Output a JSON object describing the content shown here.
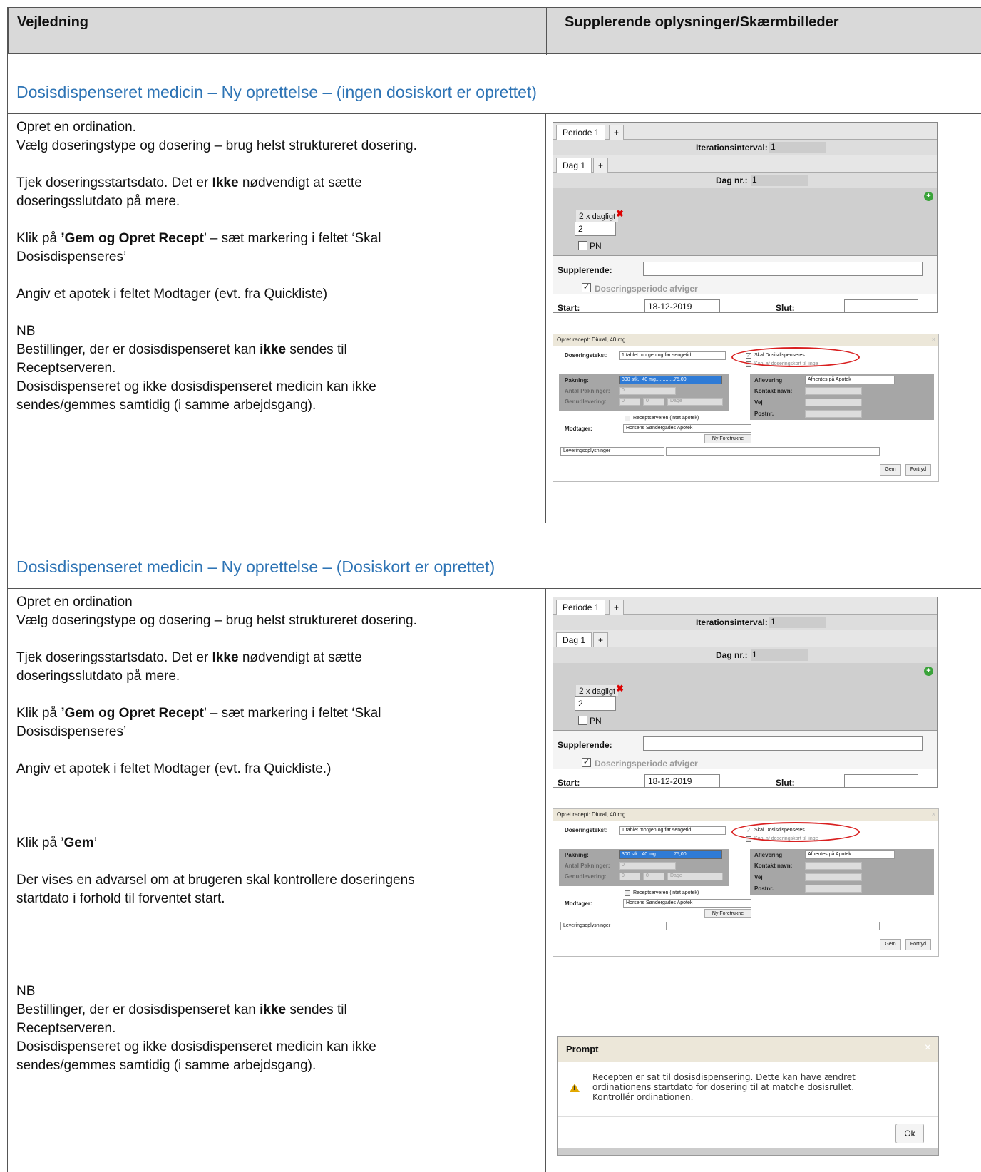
{
  "header": {
    "col1": "Vejledning",
    "col2": "Supplerende oplysninger/Skærmbilleder"
  },
  "section1": {
    "title": "Dosisdispenseret medicin – Ny oprettelse – (ingen dosiskort er oprettet)",
    "p1_l1": "Opret en ordination.",
    "p1_l2": "Vælg doseringstype og dosering – brug helst struktureret dosering.",
    "p2_a": "Tjek doseringsstartsdato. Det er ",
    "p2_b": "Ikke",
    "p2_c": " nødvendigt at sætte",
    "p2_l2": "doseringsslutdato på mere.",
    "p3_a": "Klik på ",
    "p3_b": "’Gem og Opret Recept",
    "p3_c": "’ – sæt markering i feltet ‘Skal",
    "p3_l2": "Dosisdispenseres’",
    "p4": "Angiv et apotek i feltet Modtager (evt. fra Quickliste)",
    "nb": "NB",
    "nb1_a": "Bestillinger, der er dosisdispenseret kan ",
    "nb1_b": "ikke",
    "nb1_c": " sendes til",
    "nb1_l2": "Receptserveren.",
    "nb2_l1": "Dosisdispenseret og ikke dosisdispenseret medicin kan ikke",
    "nb2_l2": "sendes/gemmes samtidig (i samme arbejdsgang)."
  },
  "section2": {
    "title": "Dosisdispenseret medicin – Ny oprettelse – (Dosiskort er oprettet)",
    "p1_l1": "Opret en ordination",
    "p1_l2": "Vælg doseringstype og dosering – brug helst struktureret dosering.",
    "p2_a": "Tjek doseringsstartsdato. Det er ",
    "p2_b": "Ikke",
    "p2_c": " nødvendigt at sætte",
    "p2_l2": "doseringsslutdato på mere.",
    "p3_a": "Klik på ",
    "p3_b": "’Gem og Opret Recept",
    "p3_c": "’ – sæt markering i feltet ‘Skal",
    "p3_l2": "Dosisdispenseres’",
    "p4": "Angiv et apotek i feltet Modtager (evt. fra Quickliste.)",
    "p5_a": "Klik på ’",
    "p5_b": "Gem",
    "p5_c": "’",
    "p6_l1": "Der vises en advarsel om at brugeren skal kontrollere doseringens",
    "p6_l2": "startdato i forhold til forventet start.",
    "nb": "NB",
    "nb1_a": "Bestillinger, der er dosisdispenseret kan ",
    "nb1_b": "ikke",
    "nb1_c": " sendes til",
    "nb1_l2": "Receptserveren.",
    "nb2_l1": "Dosisdispenseret og ikke dosisdispenseret medicin kan ikke",
    "nb2_l2": "sendes/gemmes samtidig (i samme arbejdsgang)."
  },
  "dosing": {
    "periode_tab": "Periode 1",
    "plus": "+",
    "iter_label": "Iterationsinterval:",
    "iter_value": "1",
    "dag_tab": "Dag 1",
    "dagnr_label": "Dag nr.:",
    "dagnr_value": "1",
    "dose_count": "2",
    "dose_suffix": "x dagligt",
    "dose_input": "2",
    "pn_label": "PN",
    "supp_label": "Supplerende:",
    "afviger_label": "Doseringsperiode afviger",
    "start_label": "Start:",
    "start_value": "18-12-2019",
    "slut_label": "Slut:",
    "check_mark": "✓",
    "remove_mark": "✖"
  },
  "recipe": {
    "title": "Opret recept: Diural, 40 mg",
    "close": "×",
    "doseringstekst_label": "Doseringstekst:",
    "doseringstekst_value": "1 tablet morgen og før sengetid",
    "skal_label": "Skal Dosisdispenseres",
    "kopi_label": "Kopi af doseringskort til linge",
    "pakning_label": "Pakning:",
    "pakning_value": "300 stk., 40 mg.............75,00",
    "antal_label": "Antal Pakninger:",
    "antal_value": "0",
    "genud_label": "Genudlevering:",
    "genud_v1": "0",
    "genud_v2": "0",
    "genud_unit": "Dage",
    "aflevering_label": "Aflevering",
    "aflevering_value": "Afhentes på Apotek",
    "kontakt_label": "Kontakt navn:",
    "vej_label": "Vej",
    "postnr_label": "Postnr.",
    "receptserver_label": "Receptserveren (intet apotek)",
    "modtager_label": "Modtager:",
    "modtager_value": "Horsens Søndergades Apotek",
    "ny_btn": "Ny Foretrukne",
    "lev_value": "Leveringsoplysninger",
    "gem_btn": "Gem",
    "fortryd_btn": "Fortryd"
  },
  "prompt": {
    "title": "Prompt",
    "close": "×",
    "message": "Recepten er sat til dosisdispensering. Dette kan have ændret ordinationens startdato for dosering til at matche dosisrullet. Kontrollér ordinationen.",
    "warn_mark": "!",
    "ok": "Ok"
  },
  "colors": {
    "section_title": "#2e74b5",
    "header_bg": "#d9d9d9",
    "highlight_oval": "#d92020"
  }
}
